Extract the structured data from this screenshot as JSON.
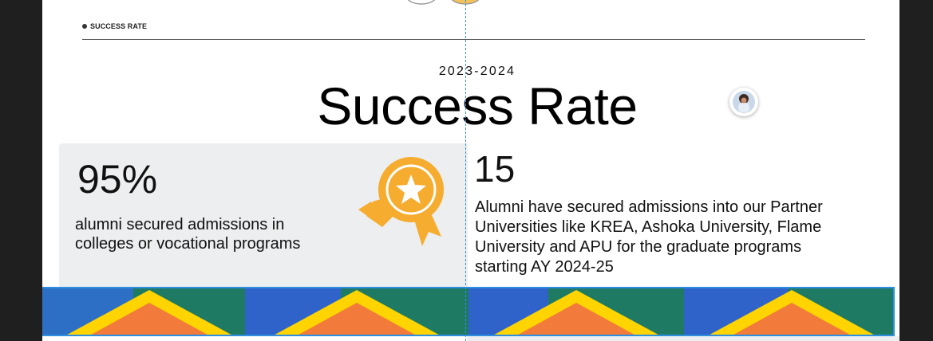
{
  "section_tag": "SUCCESS RATE",
  "year": "2023-2024",
  "title": "Success Rate",
  "stats": {
    "left": {
      "value": "95%",
      "description": "alumni secured admissions in colleges or vocational programs",
      "icon": "award-icon"
    },
    "right": {
      "value": "15",
      "description": "Alumni have secured admissions into our Partner Universities like KREA, Ashoka University, Flame University and APU for the graduate programs starting AY 2024-25"
    }
  },
  "colors": {
    "award": "#f6ac2f",
    "card_bg": "#eceeef",
    "pattern_blue": "#2f63c9",
    "pattern_green": "#1e7a62",
    "pattern_yellow": "#ffd400",
    "pattern_orange": "#f27a3a",
    "selection": "#2f8fe0"
  }
}
